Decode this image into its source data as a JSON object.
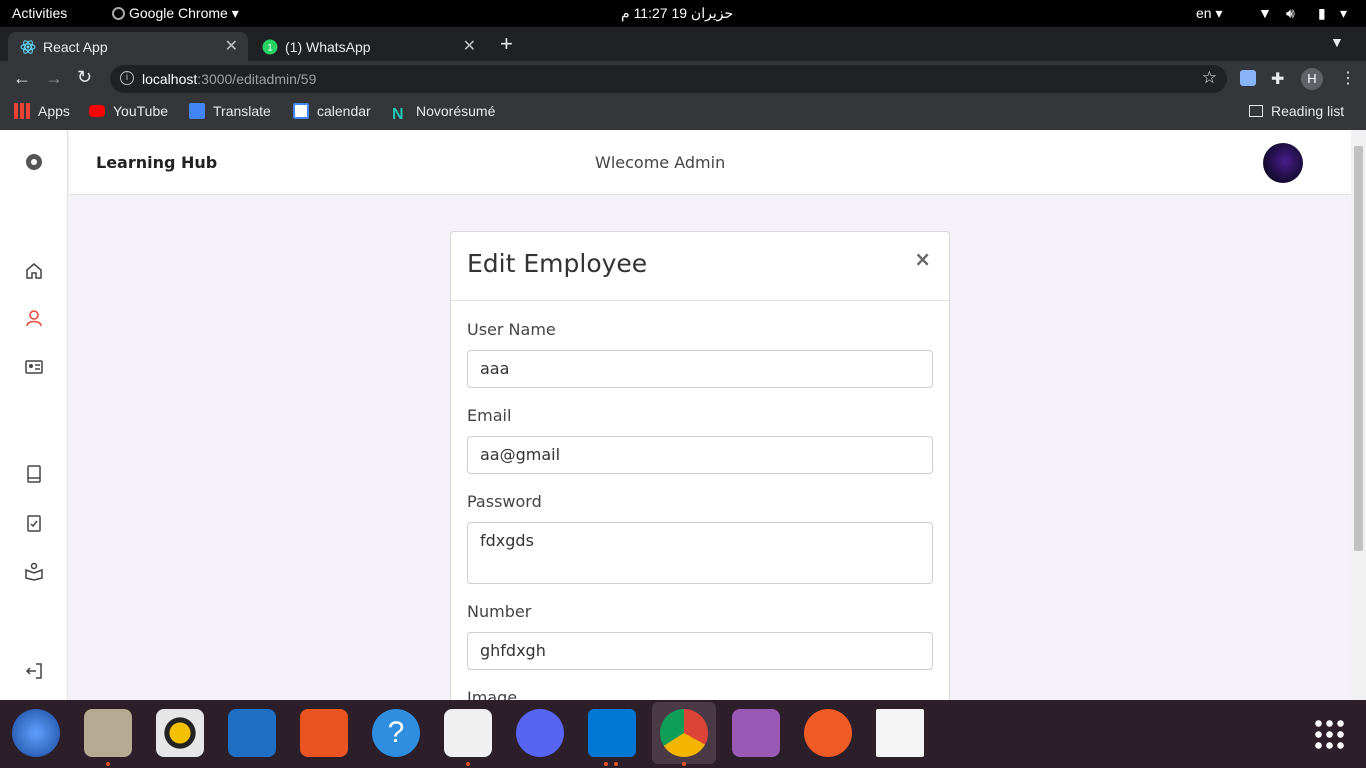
{
  "system_bar": {
    "activities": "Activities",
    "app_menu": "Google Chrome",
    "clock": "حزيران 19  11:27 م",
    "language": "en"
  },
  "browser": {
    "tabs": [
      {
        "title": "React App",
        "active": true
      },
      {
        "title": "(1) WhatsApp",
        "active": false
      }
    ],
    "url_host": "localhost",
    "url_path": ":3000/editadmin/59",
    "profile_initial": "H",
    "bookmarks": [
      "Apps",
      "YouTube",
      "Translate",
      "calendar",
      "Novorésumé"
    ],
    "reading_list": "Reading list"
  },
  "app": {
    "brand": "Learning Hub",
    "welcome": "Wlecome Admin",
    "modal": {
      "title": "Edit Employee",
      "close": "×",
      "fields": [
        {
          "label": "User Name",
          "value": "aaa"
        },
        {
          "label": "Email",
          "value": "aa@gmail"
        },
        {
          "label": "Password",
          "value": "fdxgds"
        },
        {
          "label": "Number",
          "value": "ghfdxgh"
        },
        {
          "label": "Image",
          "value": ""
        }
      ]
    }
  },
  "colors": {
    "accent": "#e74c3c",
    "chrome_dark": "#35363a",
    "page_bg": "#f4f2f8"
  }
}
